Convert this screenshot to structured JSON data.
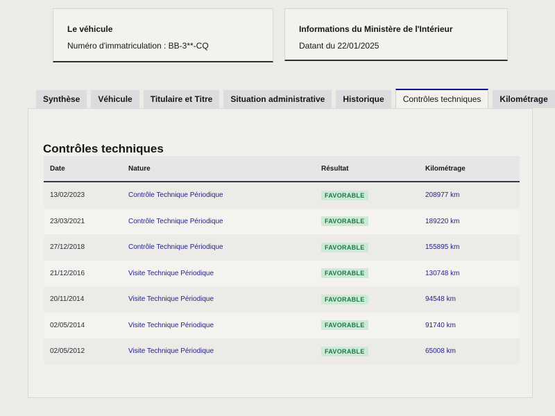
{
  "vehicle_card": {
    "title": "Le véhicule",
    "plate_line": "Numéro d'immatriculation : BB-3**-CQ"
  },
  "ministry_card": {
    "title": "Informations du Ministère de l'Intérieur",
    "date_line": "Datant du 22/01/2025"
  },
  "tabs": [
    {
      "label": "Synthèse",
      "active": false
    },
    {
      "label": "Véhicule",
      "active": false
    },
    {
      "label": "Titulaire et Titre",
      "active": false
    },
    {
      "label": "Situation administrative",
      "active": false
    },
    {
      "label": "Historique",
      "active": false
    },
    {
      "label": "Contrôles techniques",
      "active": true
    },
    {
      "label": "Kilométrage",
      "active": false
    }
  ],
  "section_title": "Contrôles techniques",
  "table": {
    "headers": [
      "Date",
      "Nature",
      "Résultat",
      "Kilométrage"
    ],
    "rows": [
      {
        "date": "13/02/2023",
        "nature": "Contrôle Technique Périodique",
        "result": "FAVORABLE",
        "km": "208977 km"
      },
      {
        "date": "23/03/2021",
        "nature": "Contrôle Technique Périodique",
        "result": "FAVORABLE",
        "km": "189220 km"
      },
      {
        "date": "27/12/2018",
        "nature": "Contrôle Technique Périodique",
        "result": "FAVORABLE",
        "km": "155895 km"
      },
      {
        "date": "21/12/2016",
        "nature": "Visite Technique Périodique",
        "result": "FAVORABLE",
        "km": "130748 km"
      },
      {
        "date": "20/11/2014",
        "nature": "Visite Technique Périodique",
        "result": "FAVORABLE",
        "km": "94548 km"
      },
      {
        "date": "02/05/2014",
        "nature": "Visite Technique Périodique",
        "result": "FAVORABLE",
        "km": "91740 km"
      },
      {
        "date": "02/05/2012",
        "nature": "Visite Technique Périodique",
        "result": "FAVORABLE",
        "km": "65008 km"
      }
    ]
  },
  "colors": {
    "accent_blue": "#000091",
    "success_bg": "#cfe9d7",
    "success_text": "#1a7a45"
  }
}
